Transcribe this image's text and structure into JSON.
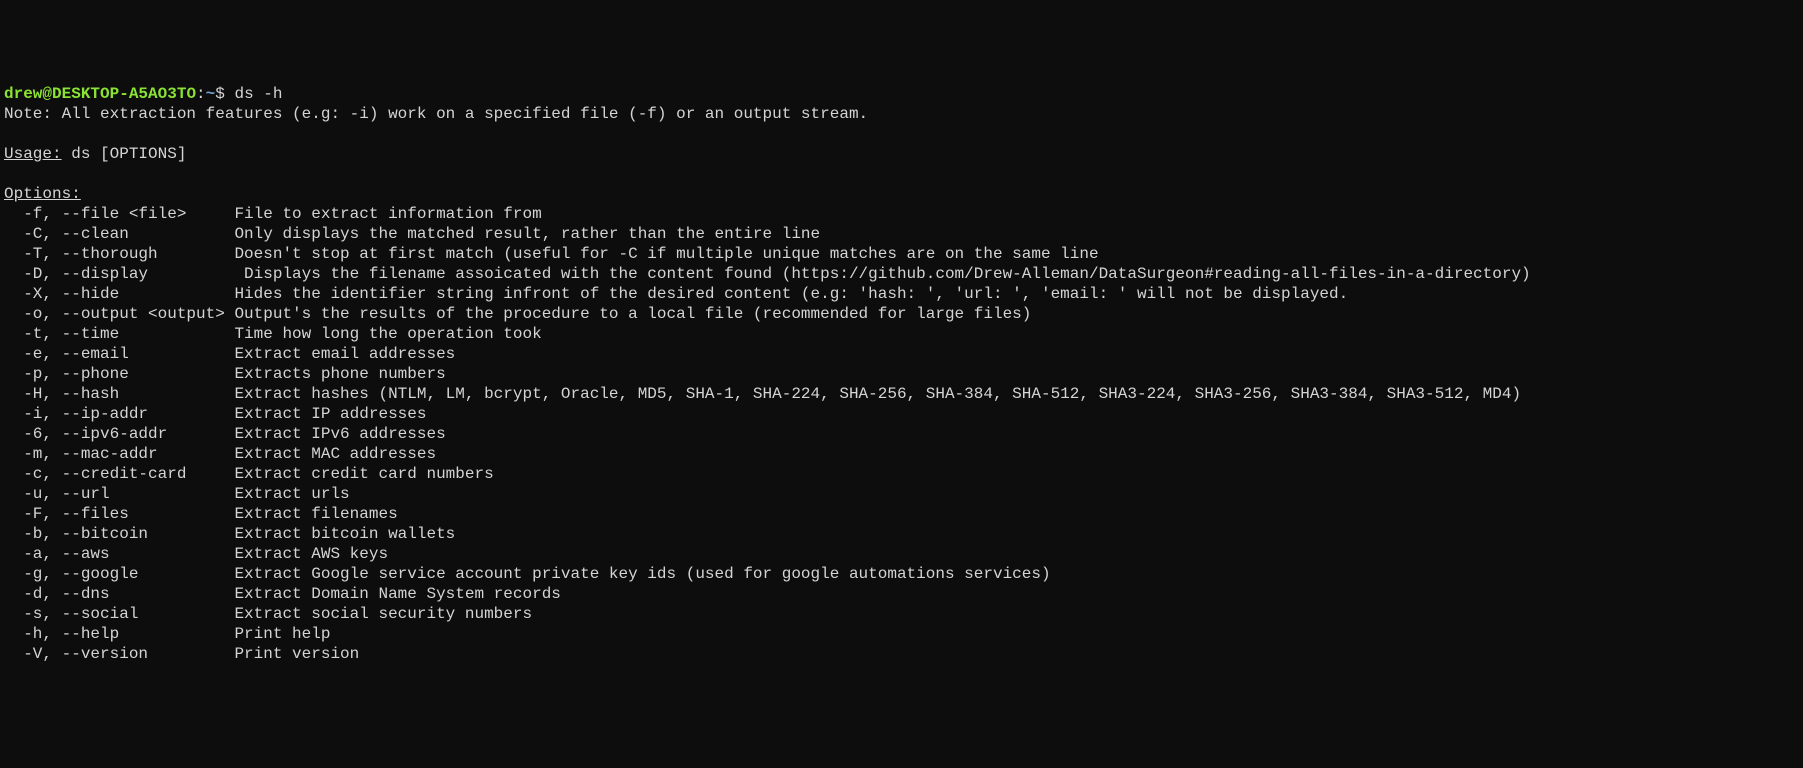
{
  "prompt": {
    "user": "drew",
    "at": "@",
    "host": "DESKTOP-A5AO3TO",
    "colon": ":",
    "path": "~",
    "dollar": "$ "
  },
  "command": "ds -h",
  "note": "Note: All extraction features (e.g: -i) work on a specified file (-f) or an output stream.",
  "usage_label": "Usage:",
  "usage_text": " ds [OPTIONS]",
  "options_label": "Options:",
  "options": [
    {
      "flags": "  -f, --file <file>     ",
      "desc": "File to extract information from"
    },
    {
      "flags": "  -C, --clean           ",
      "desc": "Only displays the matched result, rather than the entire line"
    },
    {
      "flags": "  -T, --thorough        ",
      "desc": "Doesn't stop at first match (useful for -C if multiple unique matches are on the same line"
    },
    {
      "flags": "  -D, --display         ",
      "desc": " Displays the filename assoicated with the content found (https://github.com/Drew-Alleman/DataSurgeon#reading-all-files-in-a-directory)"
    },
    {
      "flags": "  -X, --hide            ",
      "desc": "Hides the identifier string infront of the desired content (e.g: 'hash: ', 'url: ', 'email: ' will not be displayed."
    },
    {
      "flags": "  -o, --output <output> ",
      "desc": "Output's the results of the procedure to a local file (recommended for large files)"
    },
    {
      "flags": "  -t, --time            ",
      "desc": "Time how long the operation took"
    },
    {
      "flags": "  -e, --email           ",
      "desc": "Extract email addresses"
    },
    {
      "flags": "  -p, --phone           ",
      "desc": "Extracts phone numbers"
    },
    {
      "flags": "  -H, --hash            ",
      "desc": "Extract hashes (NTLM, LM, bcrypt, Oracle, MD5, SHA-1, SHA-224, SHA-256, SHA-384, SHA-512, SHA3-224, SHA3-256, SHA3-384, SHA3-512, MD4)"
    },
    {
      "flags": "  -i, --ip-addr         ",
      "desc": "Extract IP addresses"
    },
    {
      "flags": "  -6, --ipv6-addr       ",
      "desc": "Extract IPv6 addresses"
    },
    {
      "flags": "  -m, --mac-addr        ",
      "desc": "Extract MAC addresses"
    },
    {
      "flags": "  -c, --credit-card     ",
      "desc": "Extract credit card numbers"
    },
    {
      "flags": "  -u, --url             ",
      "desc": "Extract urls"
    },
    {
      "flags": "  -F, --files           ",
      "desc": "Extract filenames"
    },
    {
      "flags": "  -b, --bitcoin         ",
      "desc": "Extract bitcoin wallets"
    },
    {
      "flags": "  -a, --aws             ",
      "desc": "Extract AWS keys"
    },
    {
      "flags": "  -g, --google          ",
      "desc": "Extract Google service account private key ids (used for google automations services)"
    },
    {
      "flags": "  -d, --dns             ",
      "desc": "Extract Domain Name System records"
    },
    {
      "flags": "  -s, --social          ",
      "desc": "Extract social security numbers"
    },
    {
      "flags": "  -h, --help            ",
      "desc": "Print help"
    },
    {
      "flags": "  -V, --version         ",
      "desc": "Print version"
    }
  ]
}
